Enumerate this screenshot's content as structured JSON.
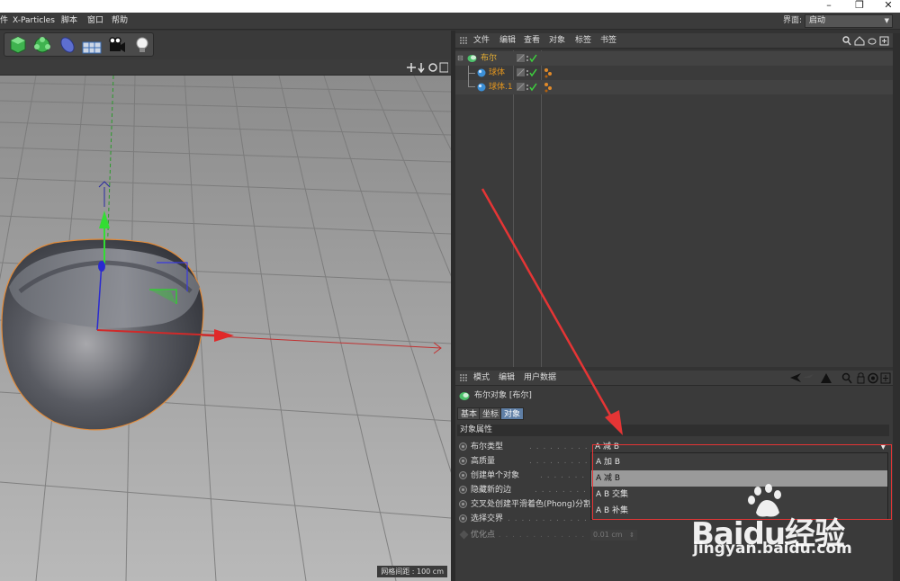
{
  "menubar": {
    "items": [
      "件",
      "X-Particles",
      "脚本",
      "窗口",
      "帮助"
    ],
    "layout_label": "界面:",
    "layout_value": "启动"
  },
  "viewport": {
    "grid_readout": "网格间距 : 100 cm"
  },
  "object_manager": {
    "menu": [
      "文件",
      "编辑",
      "查看",
      "对象",
      "标签",
      "书签"
    ],
    "objects": [
      {
        "name": "布尔",
        "color": "#e8b033"
      },
      {
        "name": "球体",
        "color": "#e0941f"
      },
      {
        "name": "球体.1",
        "color": "#e0941f"
      }
    ]
  },
  "attribute_manager": {
    "menu": [
      "模式",
      "编辑",
      "用户数据"
    ],
    "object_title": "布尔对象 [布尔]",
    "tabs": [
      {
        "label": "基本",
        "active": false
      },
      {
        "label": "坐标",
        "active": false
      },
      {
        "label": "对象",
        "active": true
      }
    ],
    "section": "对象属性",
    "properties": [
      "布尔类型",
      "高质量",
      "创建单个对象",
      "隐藏新的边",
      "交叉处创建平滑着色(Phong)分割",
      "选择交界",
      "优化点"
    ],
    "bool_type_value": "A 减 B",
    "dropdown_options": [
      {
        "label": "A 加 B",
        "selected": false
      },
      {
        "label": "A 减 B",
        "selected": true
      },
      {
        "label": "A B 交集",
        "selected": false
      },
      {
        "label": "A B 补集",
        "selected": false
      }
    ],
    "optimize_value": "0.01 cm"
  },
  "watermark": {
    "main": "Baidu经验",
    "url": "jingyan.baidu.com"
  },
  "colors": {
    "accent_red": "#e53535",
    "selection_blue": "#5f7fa6",
    "object_orange": "#e0941f"
  }
}
